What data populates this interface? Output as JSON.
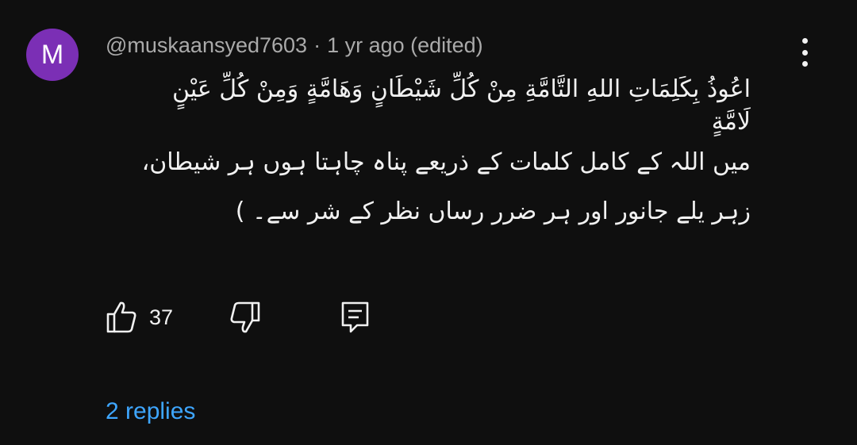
{
  "comment": {
    "avatar_letter": "M",
    "avatar_color": "#7b2fb5",
    "username": "@muskaansyed7603",
    "separator": "·",
    "time": "1 yr ago (edited)",
    "arabic_line1": "اعُوذُ بِكَلِمَاتِ اللهِ التَّامَّةِ مِنْ كُلِّ شَيْطَانٍ وَهَامَّةٍ وَمِنْ كُلِّ عَيْنٍ",
    "arabic_line2": "لَامَّةٍ",
    "urdu_line1": "میں اللہ کے کامل کلمات کے ذریعے پناہ چاہتا ہوں ہر شیطان،",
    "urdu_line2": "زہر یلے جانور اور ہر ضرر رساں نظر کے شر سے۔ )"
  },
  "actions": {
    "like_count": "37",
    "like_icon": "thumbs-up-icon",
    "dislike_icon": "thumbs-down-icon",
    "reply_icon": "comment-icon"
  },
  "replies_label": "2 replies",
  "colors": {
    "background": "#0f0f0f",
    "text": "#f1f1f1",
    "secondary": "#aaaaaa",
    "link": "#3ea6ff"
  }
}
